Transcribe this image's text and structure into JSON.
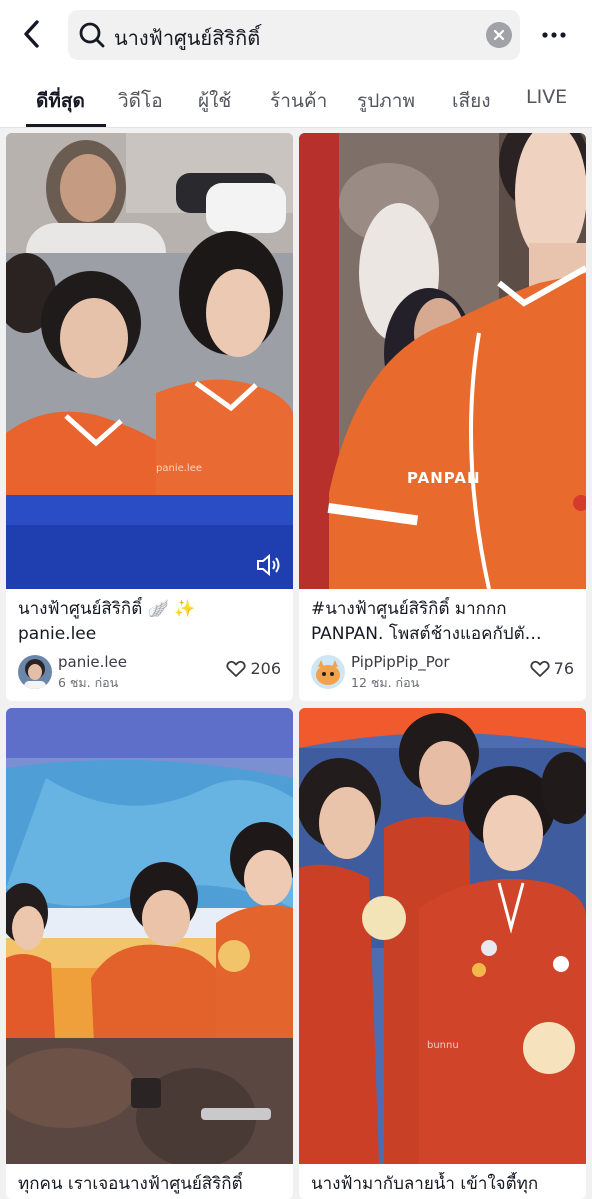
{
  "search": {
    "query": "นางฟ้าศูนย์สิริกิติ์"
  },
  "tabs": [
    "ดีที่สุด",
    "วิดีโอ",
    "ผู้ใช้",
    "ร้านค้า",
    "รูปภาพ",
    "เสียง",
    "LIVE"
  ],
  "cards": [
    {
      "caption_line1": "นางฟ้าศูนย์สิริกิติ์ 🪽 ✨",
      "caption_line2": "panie.lee",
      "username": "panie.lee",
      "time": "6 ชม. ก่อน",
      "likes": "206",
      "watermark": "panie.lee"
    },
    {
      "caption_line1": "#นางฟ้าศูนย์สิริกิติ์ มากกก",
      "caption_line2": "PANPAN. โพสต์ช้างแอคกัปตั…",
      "username": "PipPipPip_Por",
      "time": "12 ชม. ก่อน",
      "likes": "76",
      "watermark": "PANPAN"
    },
    {
      "caption_line1": "ทุกคน เราเจอนางฟ้าศูนย์สิริกิติ์"
    },
    {
      "caption_line1": "นางฟ้ามากับลายน้ำ เข้าใจตี้ทุก",
      "watermark": "bunnu"
    }
  ]
}
